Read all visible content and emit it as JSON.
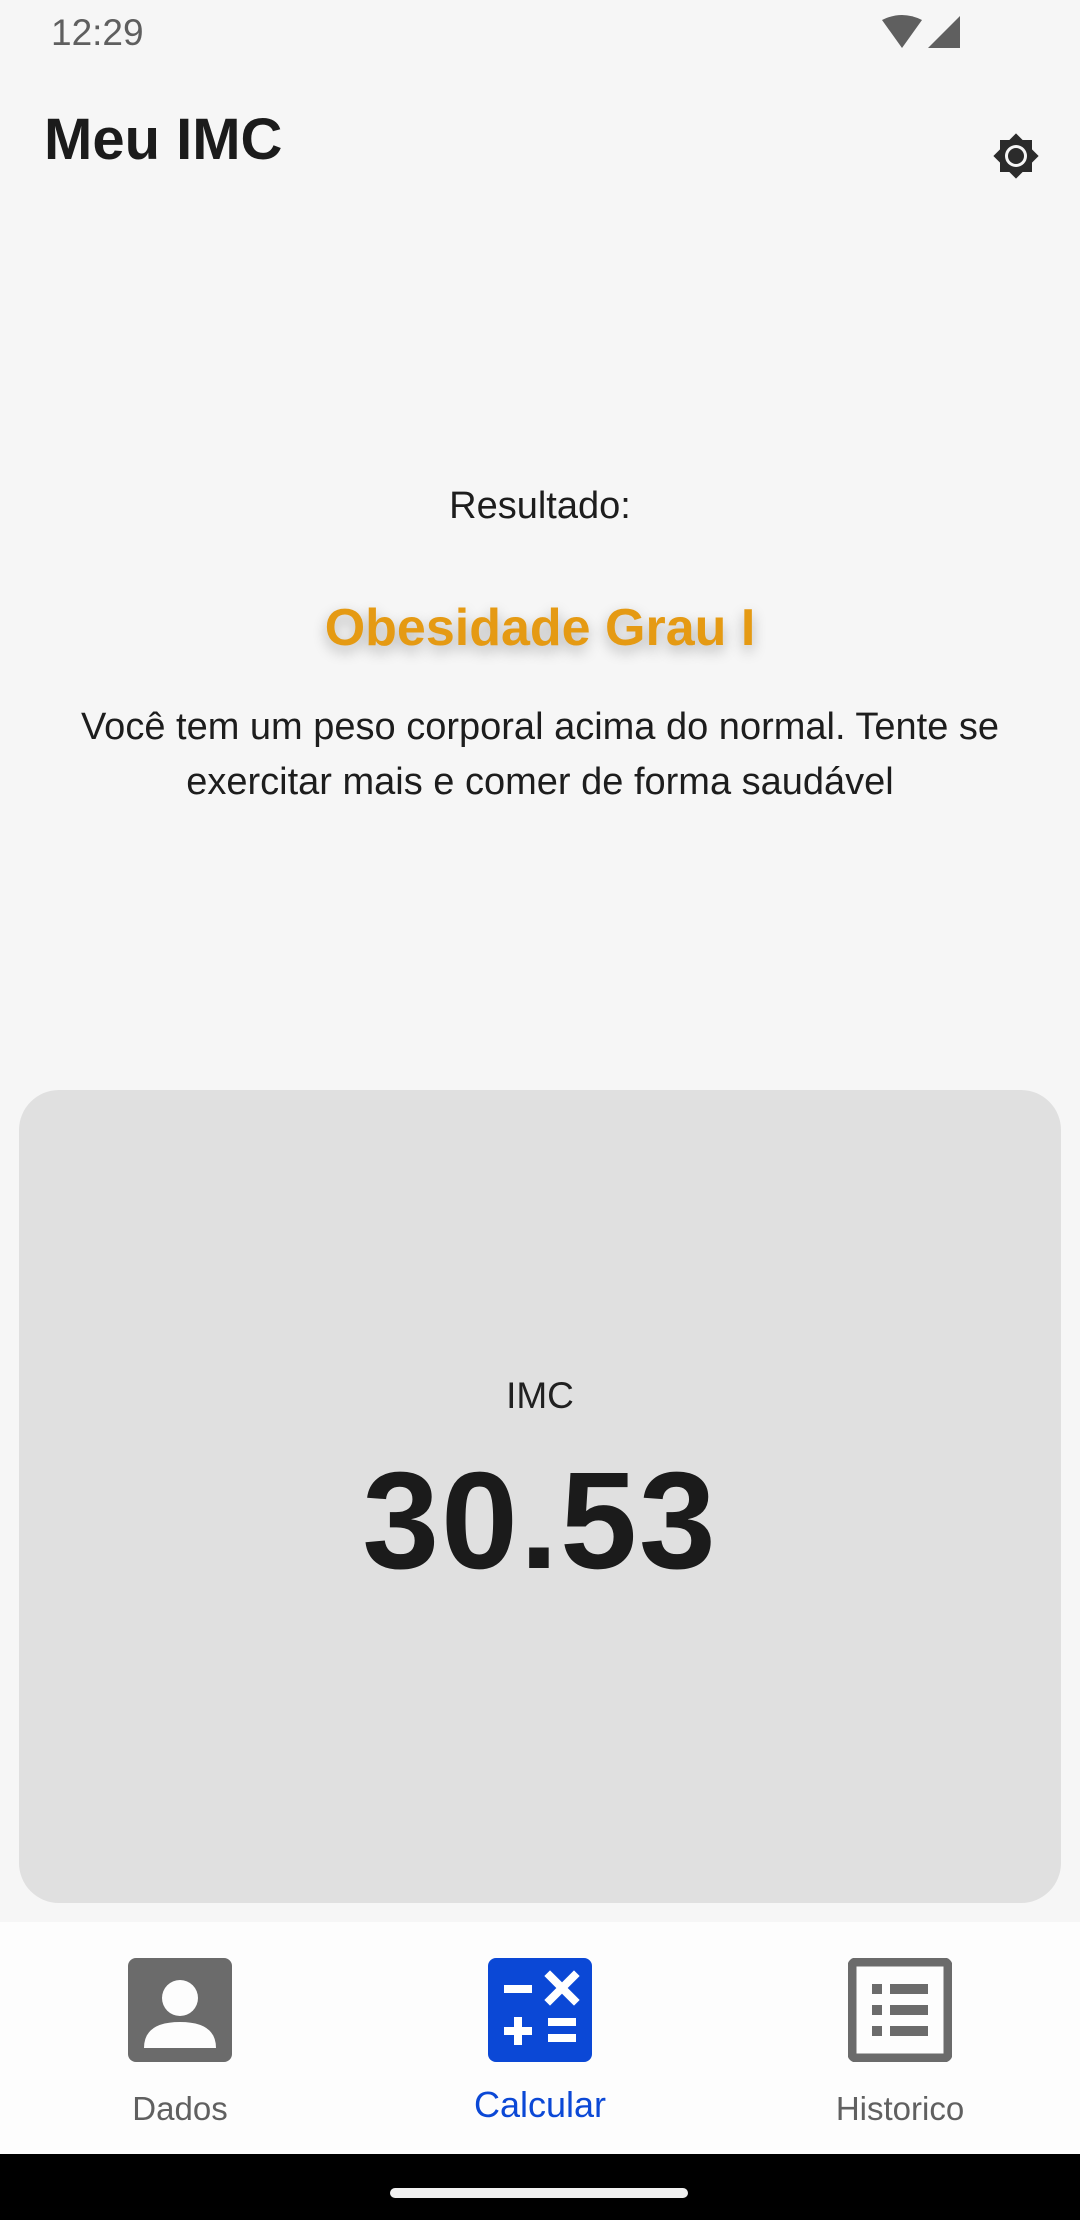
{
  "status_bar": {
    "time": "12:29"
  },
  "app_bar": {
    "title": "Meu IMC",
    "settings_icon": "brightness-settings-icon"
  },
  "result": {
    "label": "Resultado:",
    "category": "Obesidade Grau I",
    "category_color": "#e59a13",
    "message": "Você tem um peso corporal acima do normal. Tente se exercitar mais e comer de forma saudável"
  },
  "imc_card": {
    "label": "IMC",
    "value": "30.53"
  },
  "bottom_nav": {
    "active_color": "#0b48d6",
    "items": [
      {
        "label": "Dados",
        "icon": "person-icon",
        "active": false
      },
      {
        "label": "Calcular",
        "icon": "calculator-icon",
        "active": true
      },
      {
        "label": "Historico",
        "icon": "list-icon",
        "active": false
      }
    ]
  }
}
